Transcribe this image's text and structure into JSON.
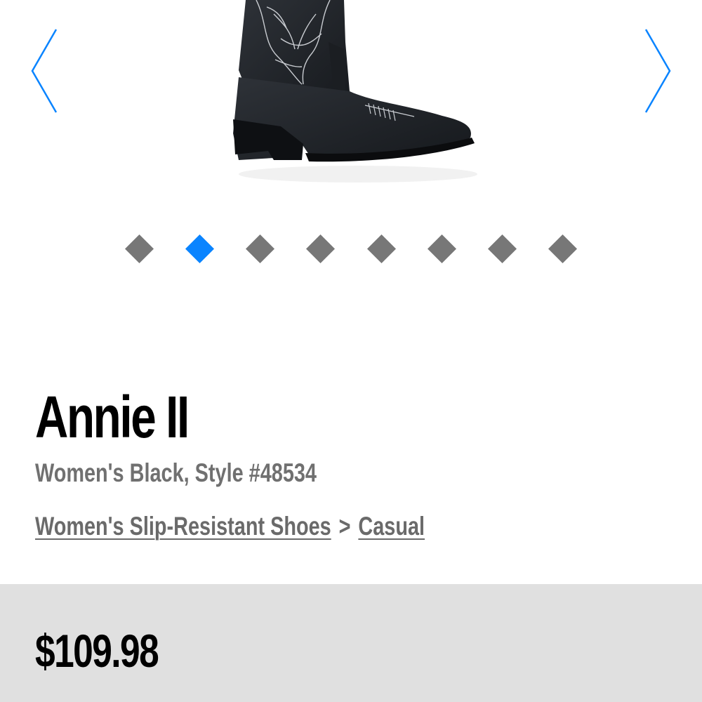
{
  "gallery": {
    "image_alt": "Women's black western boot with white embroidered shaft",
    "slides_total": 8,
    "active_slide": 2
  },
  "product": {
    "name": "Annie II",
    "subtitle": "Women's Black, Style #48534",
    "breadcrumb": {
      "category": "Women's Slip-Resistant Shoes",
      "separator": ">",
      "subcategory": "Casual"
    },
    "price": "$109.98"
  },
  "colors": {
    "accent": "#0a84ff",
    "dot_inactive": "#777777",
    "price_band": "#e0e0e0",
    "muted_text": "#707070"
  }
}
